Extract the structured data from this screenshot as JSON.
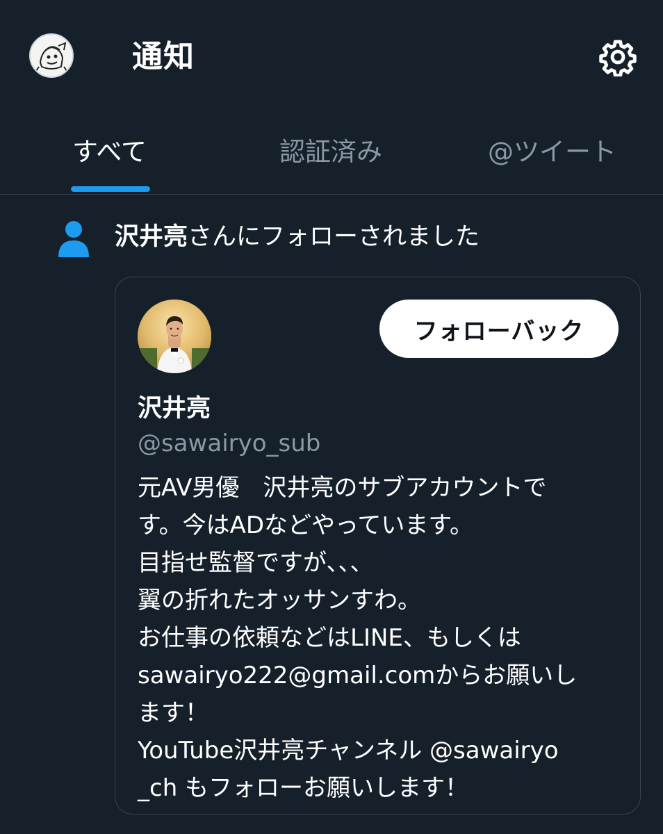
{
  "header": {
    "title": "通知",
    "settings_icon": "gear-icon",
    "avatar_icon": "avatar-illustration"
  },
  "tabs": [
    {
      "label": "すべて",
      "active": true
    },
    {
      "label": "認証済み",
      "active": false
    },
    {
      "label": "@ツイート",
      "active": false
    }
  ],
  "notification": {
    "icon": "person-icon",
    "name": "沢井亮",
    "text": "さんにフォローされました"
  },
  "card": {
    "follow_back_label": "フォローバック",
    "display_name": "沢井亮",
    "handle": "@sawairyo_sub",
    "bio_lines": [
      "元AV男優　沢井亮のサブアカウントで",
      "す。今はADなどやっています。",
      "目指せ監督ですが、、、",
      "翼の折れたオッサンすわ。",
      "お仕事の依頼などはLINE、もしくは",
      "sawairyo222@gmail.comからお願いし",
      "ます！",
      "YouTube沢井亮チャンネル @sawairyo",
      "_ch もフォローお願いします！"
    ]
  },
  "colors": {
    "background": "#15202b",
    "accent": "#1d9bf0",
    "muted_text": "#8b98a5",
    "border": "#38444d"
  }
}
